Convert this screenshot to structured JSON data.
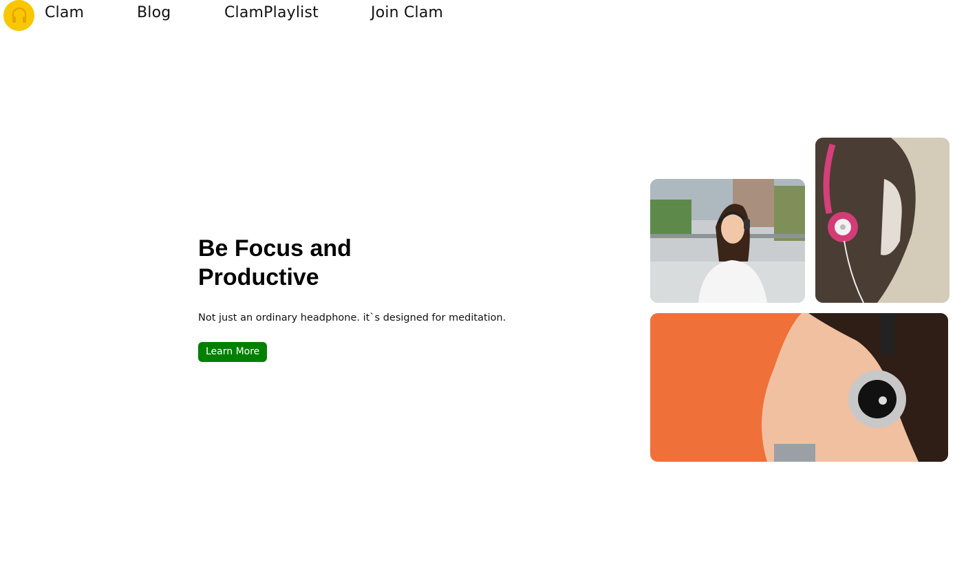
{
  "nav": {
    "logo_icon": "headphone-icon",
    "items": [
      {
        "label": "Clam"
      },
      {
        "label": "Blog"
      },
      {
        "label": "ClamPlaylist"
      },
      {
        "label": "Join Clam"
      }
    ]
  },
  "hero": {
    "title": "Be Focus and Productive",
    "subtitle": "Not just an ordinary headphone. it`s designed for meditation.",
    "cta_label": "Learn More"
  },
  "colors": {
    "logo_bg": "#f9c700",
    "cta_bg": "#008000",
    "photo3_bg": "#f0703a"
  },
  "gallery": [
    {
      "icon": "woman-with-headphones-photo"
    },
    {
      "icon": "woman-with-pink-headphones-photo"
    },
    {
      "icon": "woman-with-silver-headphones-photo"
    }
  ]
}
